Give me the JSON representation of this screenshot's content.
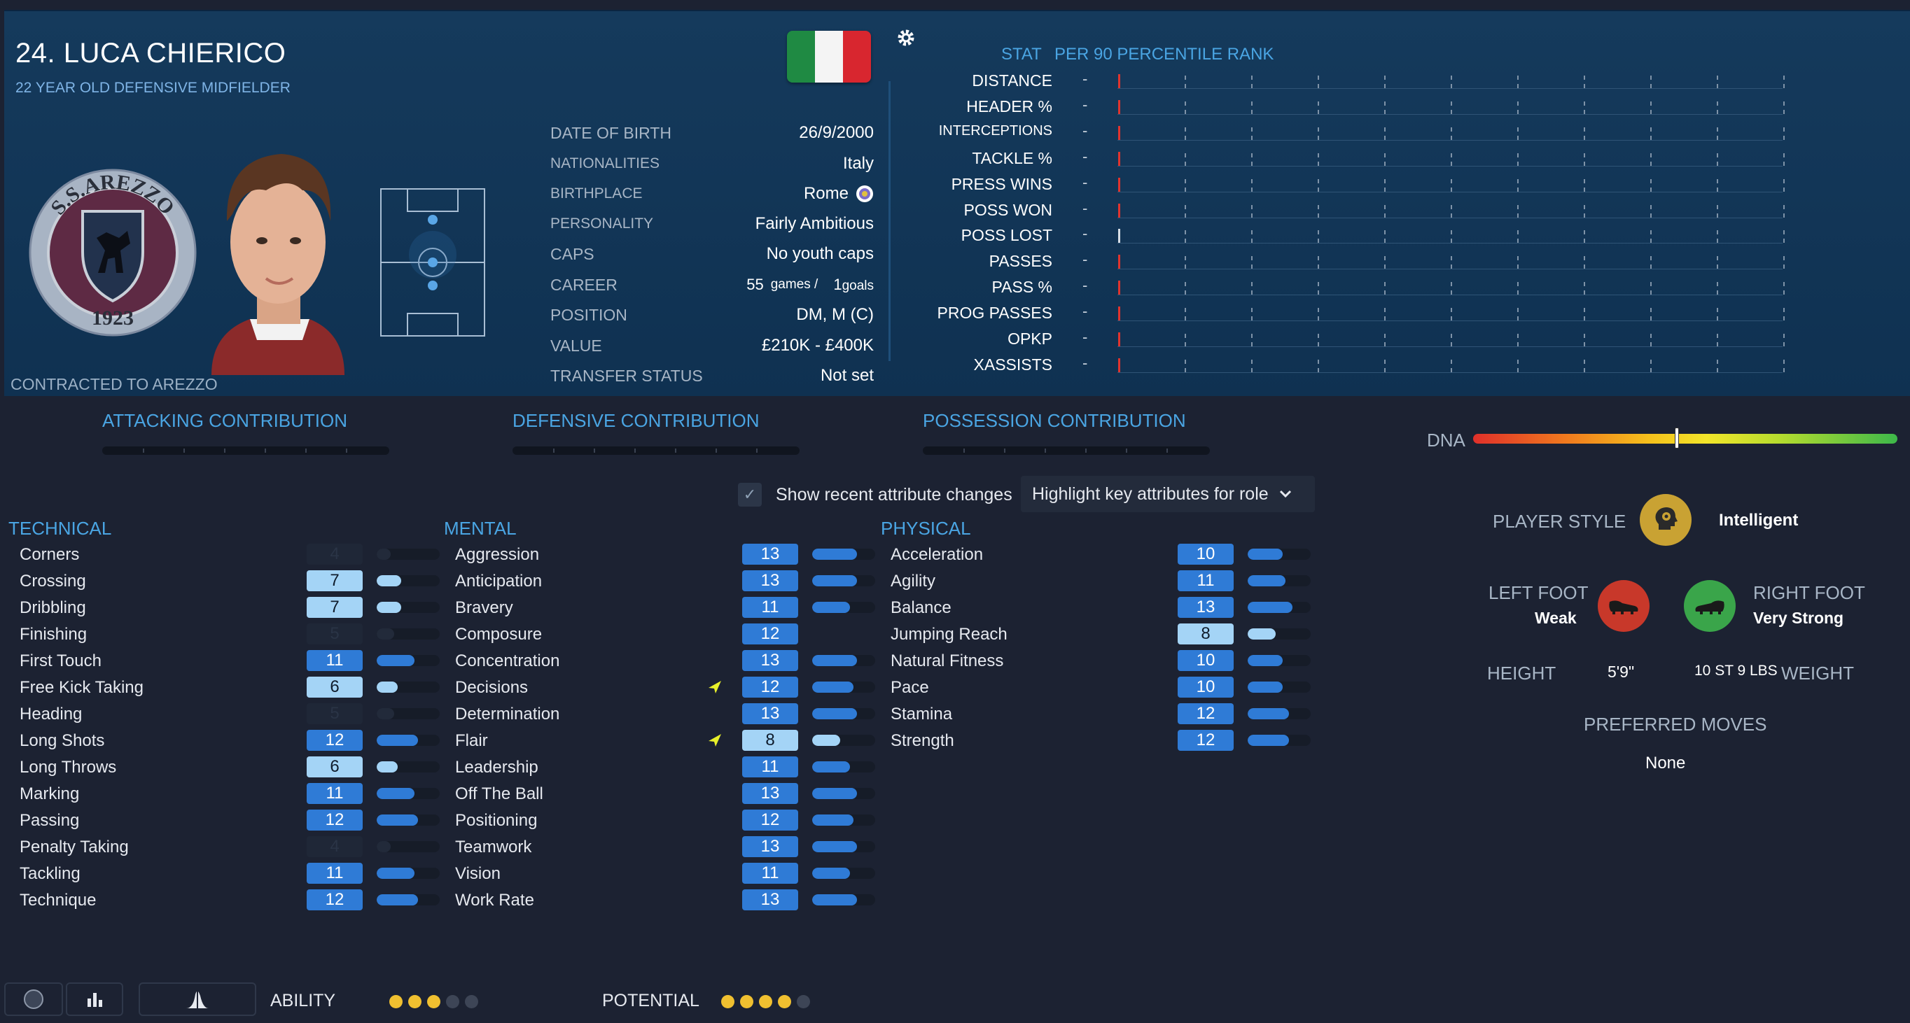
{
  "player": {
    "name": "24. LUCA CHIERICO",
    "subtitle": "22 YEAR OLD DEFENSIVE MIDFIELDER",
    "contracted": "CONTRACTED TO AREZZO",
    "club_crest_text": [
      "S.S.AREZZO",
      "1923"
    ],
    "flag_colors": [
      "#1f8a43",
      "#f4f4f4",
      "#d8262f"
    ]
  },
  "info": [
    {
      "label": "DATE OF BIRTH",
      "value": "26/9/2000"
    },
    {
      "label": "NATIONALITIES",
      "value": "Italy"
    },
    {
      "label": "BIRTHPLACE",
      "value": "Rome"
    },
    {
      "label": "PERSONALITY",
      "value": "Fairly Ambitious"
    },
    {
      "label": "CAPS",
      "value": "No youth caps"
    },
    {
      "label": "CAREER",
      "games": "55",
      "games_unit": "games /",
      "goals": "1",
      "goals_unit": "goals"
    },
    {
      "label": "POSITION",
      "value": "DM, M (C)"
    },
    {
      "label": "VALUE",
      "value": "£210K - £400K"
    },
    {
      "label": "TRANSFER STATUS",
      "value": "Not set"
    }
  ],
  "stats_panel": {
    "col_stat": "STAT",
    "col_rank": "PER 90 PERCENTILE RANK",
    "rows": [
      {
        "label": "DISTANCE",
        "value": "-",
        "percentile": 0
      },
      {
        "label": "HEADER %",
        "value": "-",
        "percentile": 0
      },
      {
        "label": "INTERCEPTIONS",
        "value": "-",
        "percentile": 0
      },
      {
        "label": "TACKLE %",
        "value": "-",
        "percentile": 0
      },
      {
        "label": "PRESS WINS",
        "value": "-",
        "percentile": 0
      },
      {
        "label": "POSS WON",
        "value": "-",
        "percentile": 0
      },
      {
        "label": "POSS LOST",
        "value": "-",
        "percentile": 0
      },
      {
        "label": "PASSES",
        "value": "-",
        "percentile": 0
      },
      {
        "label": "PASS %",
        "value": "-",
        "percentile": 0
      },
      {
        "label": "PROG PASSES",
        "value": "-",
        "percentile": 0
      },
      {
        "label": "OPKP",
        "value": "-",
        "percentile": 0
      },
      {
        "label": "XASSISTS",
        "value": "-",
        "percentile": 0
      }
    ]
  },
  "contributions": [
    "ATTACKING CONTRIBUTION",
    "DEFENSIVE CONTRIBUTION",
    "POSSESSION CONTRIBUTION"
  ],
  "dna": {
    "label": "DNA",
    "value": 0.48
  },
  "controls": {
    "show_recent": "Show recent attribute changes",
    "highlight": "Highlight key attributes for role",
    "checked": true
  },
  "technical": {
    "title": "TECHNICAL",
    "items": [
      {
        "name": "Corners",
        "value": 4
      },
      {
        "name": "Crossing",
        "value": 7
      },
      {
        "name": "Dribbling",
        "value": 7
      },
      {
        "name": "Finishing",
        "value": 5
      },
      {
        "name": "First Touch",
        "value": 11
      },
      {
        "name": "Free Kick Taking",
        "value": 6
      },
      {
        "name": "Heading",
        "value": 5
      },
      {
        "name": "Long Shots",
        "value": 12
      },
      {
        "name": "Long Throws",
        "value": 6
      },
      {
        "name": "Marking",
        "value": 11
      },
      {
        "name": "Passing",
        "value": 12
      },
      {
        "name": "Penalty Taking",
        "value": 4
      },
      {
        "name": "Tackling",
        "value": 11
      },
      {
        "name": "Technique",
        "value": 12
      }
    ]
  },
  "mental": {
    "title": "MENTAL",
    "items": [
      {
        "name": "Aggression",
        "value": 13
      },
      {
        "name": "Anticipation",
        "value": 13
      },
      {
        "name": "Bravery",
        "value": 11
      },
      {
        "name": "Composure",
        "value": 12
      },
      {
        "name": "Concentration",
        "value": 13
      },
      {
        "name": "Decisions",
        "value": 12,
        "changed": true
      },
      {
        "name": "Determination",
        "value": 13
      },
      {
        "name": "Flair",
        "value": 8,
        "changed": true
      },
      {
        "name": "Leadership",
        "value": 11
      },
      {
        "name": "Off The Ball",
        "value": 13
      },
      {
        "name": "Positioning",
        "value": 12
      },
      {
        "name": "Teamwork",
        "value": 13
      },
      {
        "name": "Vision",
        "value": 11
      },
      {
        "name": "Work Rate",
        "value": 13
      }
    ]
  },
  "physical": {
    "title": "PHYSICAL",
    "items": [
      {
        "name": "Acceleration",
        "value": 10
      },
      {
        "name": "Agility",
        "value": 11
      },
      {
        "name": "Balance",
        "value": 13
      },
      {
        "name": "Jumping Reach",
        "value": 8
      },
      {
        "name": "Natural Fitness",
        "value": 10
      },
      {
        "name": "Pace",
        "value": 10
      },
      {
        "name": "Stamina",
        "value": 12
      },
      {
        "name": "Strength",
        "value": 12
      }
    ]
  },
  "profile": {
    "player_style_label": "PLAYER STYLE",
    "player_style": "Intelligent",
    "left_foot_label": "LEFT FOOT",
    "left_foot": "Weak",
    "right_foot_label": "RIGHT FOOT",
    "right_foot": "Very Strong",
    "height_label": "HEIGHT",
    "height": "5'9\"",
    "weight_label": "WEIGHT",
    "weight": "10 ST 9 LBS",
    "preferred_moves_label": "PREFERRED MOVES",
    "preferred_moves": "None",
    "left_foot_color": "#c8382a",
    "right_foot_color": "#3aa54a"
  },
  "footer": {
    "ability_label": "ABILITY",
    "ability_stars": 3,
    "potential_label": "POTENTIAL",
    "potential_stars": 4,
    "max_stars": 5
  }
}
